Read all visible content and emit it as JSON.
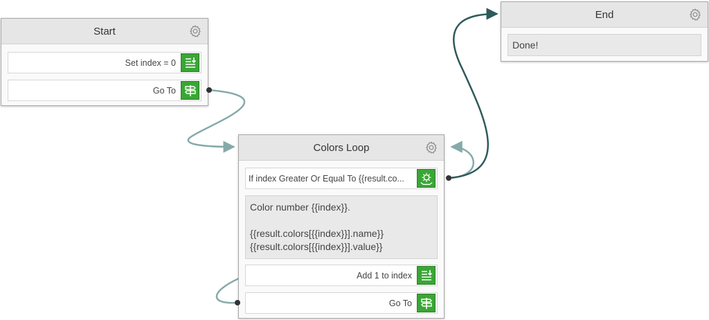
{
  "colors": {
    "connector_light": "#86aaaa",
    "connector_dark": "#2f5a5a",
    "step_icon_green": "#3aa635"
  },
  "nodes": {
    "start": {
      "title": "Start",
      "steps": [
        {
          "label": "Set index = 0",
          "icon": "set-variable-icon"
        },
        {
          "label": "Go To",
          "icon": "signpost-icon"
        }
      ]
    },
    "colors_loop": {
      "title": "Colors Loop",
      "condition": {
        "label": "If index Greater Or Equal To {{result.co...",
        "icon": "condition-gear-icon"
      },
      "message": "Color number {{index}}.\n\n{{result.colors[{{index}}].name}}\n{{result.colors[{{index}}].value}}",
      "steps": [
        {
          "label": "Add 1 to index",
          "icon": "set-variable-icon"
        },
        {
          "label": "Go To",
          "icon": "signpost-icon"
        }
      ]
    },
    "end": {
      "title": "End",
      "message": "Done!"
    }
  }
}
